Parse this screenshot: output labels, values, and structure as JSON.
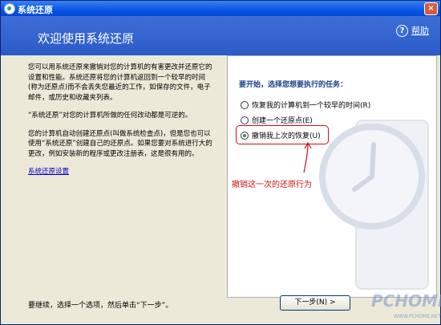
{
  "window": {
    "title": "系统还原",
    "close_label": "×"
  },
  "header": {
    "title": "欢迎使用系统还原",
    "help_label": "帮助",
    "help_icon_glyph": "?"
  },
  "intro": {
    "p1": "您可以用系统还原来撤销对您的计算机的有害更改并还原它的设置和性能。系统还原将您的计算机返回到一个较早的时间(称为还原点)而不会丢失您最近的工作，如保存的文件，电子邮件，或历史和收藏夹列表。",
    "p2": "“系统还原”对您的计算机所做的任何改动都是可逆的。",
    "p3": "您的计算机自动创建还原点(叫做系统检查点)，但是您也可以使用“系统还原”创建自己的还原点。如果您要对系统进行大的更改，例如安装新的程序或更改注册表，这是很有用的。",
    "settings_link": "系统还原设置"
  },
  "task": {
    "title": "要开始，选择您想要执行的任务：",
    "options": [
      {
        "label": "恢复我的计算机到一个较早的时间(R)",
        "checked": false
      },
      {
        "label": "创建一个还原点(E)",
        "checked": false
      },
      {
        "label": "撤销我上次的恢复(U)",
        "checked": true
      }
    ]
  },
  "annotation": "撤销这一次的还原行为",
  "footer": {
    "hint": "要继续，选择一个选项，然后单击“下一步”。",
    "next_label": "下一步(N) >"
  },
  "watermark": {
    "main": "PCHOME",
    "sub": "WWW.PCHOME.NET"
  },
  "colors": {
    "accent": "#2c5bc8",
    "annotation": "#d01010"
  }
}
